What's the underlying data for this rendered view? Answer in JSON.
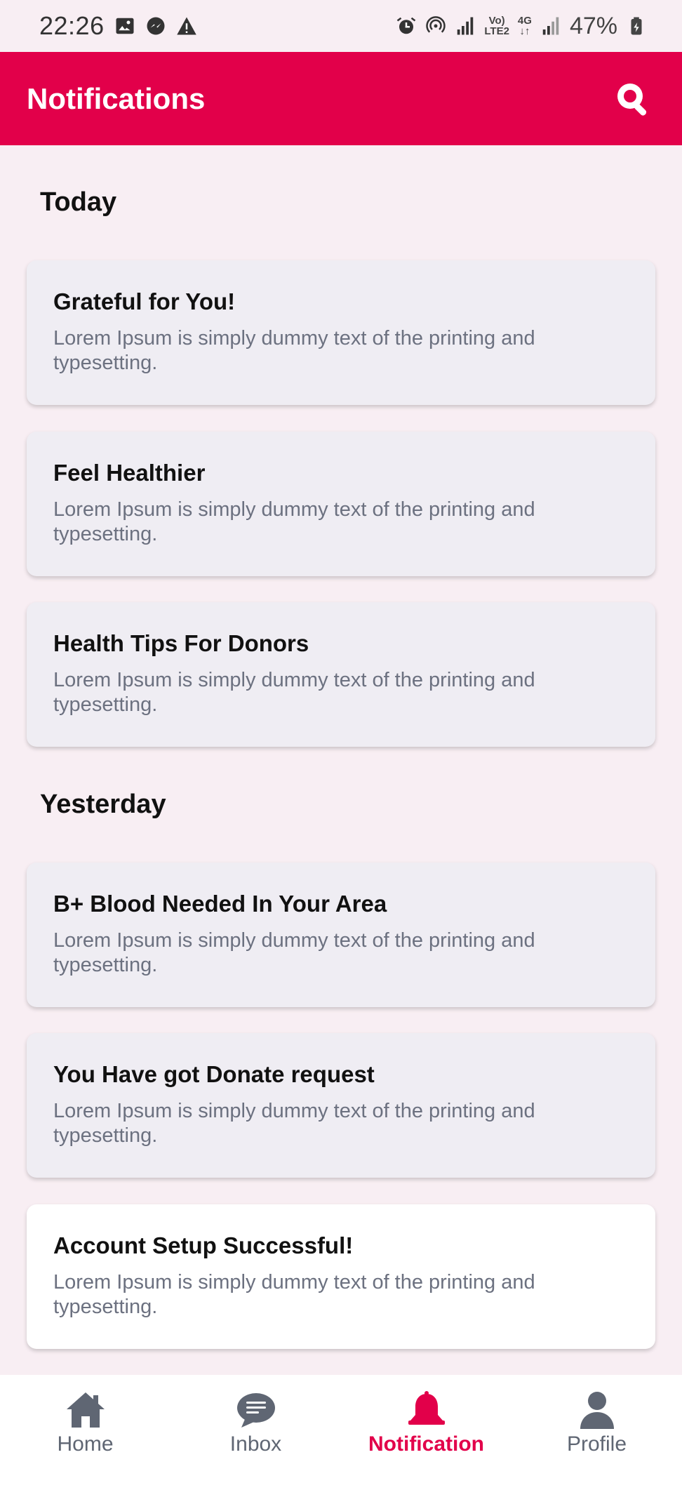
{
  "status_bar": {
    "time": "22:26",
    "battery": "47%",
    "net_top": "Vo)",
    "net_bottom": "LTE2",
    "net_4g": "4G"
  },
  "header": {
    "title": "Notifications",
    "search_icon": "search-icon"
  },
  "sections": {
    "today": "Today",
    "yesterday": "Yesterday"
  },
  "notifications": [
    {
      "title": "Grateful for You!",
      "body": "Lorem Ipsum is simply dummy text of the printing and typesetting."
    },
    {
      "title": "Feel Healthier",
      "body": "Lorem Ipsum is simply dummy text of the printing and typesetting."
    },
    {
      "title": "Health Tips For Donors",
      "body": "Lorem Ipsum is simply dummy text of the printing and typesetting."
    },
    {
      "title": "B+ Blood Needed In Your Area",
      "body": "Lorem Ipsum is simply dummy text of the printing and typesetting."
    },
    {
      "title": "You Have got Donate request",
      "body": "Lorem Ipsum is simply dummy text of the printing and typesetting."
    },
    {
      "title": "Account Setup Successful!",
      "body": "Lorem Ipsum is simply dummy text of the printing and typesetting."
    }
  ],
  "bottom_nav": {
    "items": [
      {
        "label": "Home",
        "icon": "home-icon"
      },
      {
        "label": "Inbox",
        "icon": "chat-icon"
      },
      {
        "label": "Notification",
        "icon": "bell-icon",
        "active": true
      },
      {
        "label": "Profile",
        "icon": "person-icon"
      }
    ]
  },
  "colors": {
    "brand": "#e2004a",
    "background": "#f8eef3",
    "card": "#efedf3",
    "muted_text": "#6c7180"
  }
}
